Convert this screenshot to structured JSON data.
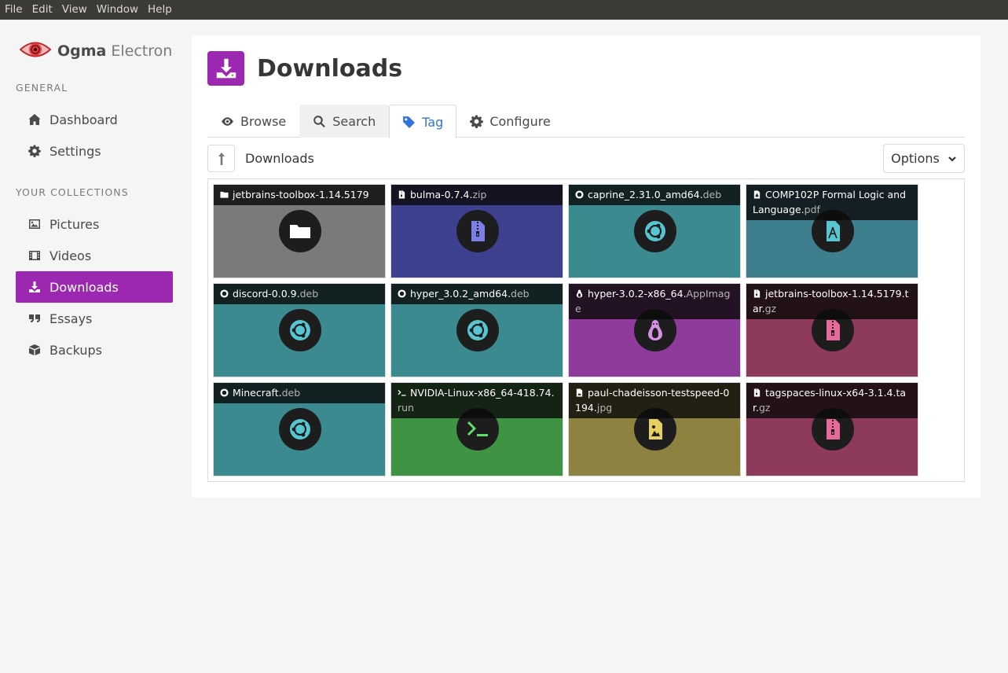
{
  "menubar": [
    "File",
    "Edit",
    "View",
    "Window",
    "Help"
  ],
  "brand": {
    "name_bold": "Ogma",
    "name_light": "Electron"
  },
  "sidebar": {
    "general_label": "GENERAL",
    "general_items": [
      {
        "label": "Dashboard",
        "icon": "home-icon"
      },
      {
        "label": "Settings",
        "icon": "gear-icon"
      }
    ],
    "collections_label": "YOUR COLLECTIONS",
    "collection_items": [
      {
        "label": "Pictures",
        "icon": "image-icon"
      },
      {
        "label": "Videos",
        "icon": "film-icon"
      },
      {
        "label": "Downloads",
        "icon": "download-icon",
        "active": true
      },
      {
        "label": "Essays",
        "icon": "quote-icon"
      },
      {
        "label": "Backups",
        "icon": "box-icon"
      }
    ]
  },
  "page": {
    "title": "Downloads",
    "accent": "#9c27b0"
  },
  "tabs": [
    {
      "label": "Browse",
      "icon": "eye-icon"
    },
    {
      "label": "Search",
      "icon": "search-icon"
    },
    {
      "label": "Tag",
      "icon": "tag-icon",
      "active": true
    },
    {
      "label": "Configure",
      "icon": "gear-icon"
    }
  ],
  "pathbar": {
    "path": "Downloads",
    "options_label": "Options"
  },
  "files": [
    {
      "name": "jetbrains-toolbox-1.14.5179",
      "ext": "",
      "kind": "folder",
      "bg": "#7a7a7a",
      "icon_color": "#ffffff"
    },
    {
      "name": "bulma-0.7.4.",
      "ext": "zip",
      "kind": "archive",
      "bg": "#3d3f8f",
      "icon_color": "#7b7fe6"
    },
    {
      "name": "caprine_2.31.0_amd64.",
      "ext": "deb",
      "kind": "deb",
      "bg": "#3a8a90",
      "icon_color": "#56c6d2"
    },
    {
      "name": "COMP102P Formal Logic and Language.",
      "ext": "pdf",
      "kind": "pdf",
      "bg": "#3d7f8f",
      "icon_color": "#56c6d2"
    },
    {
      "name": "discord-0.0.9.",
      "ext": "deb",
      "kind": "deb",
      "bg": "#3a8a90",
      "icon_color": "#56c6d2"
    },
    {
      "name": "hyper_3.0.2_amd64.",
      "ext": "deb",
      "kind": "deb",
      "bg": "#3a8a90",
      "icon_color": "#56c6d2"
    },
    {
      "name": "hyper-3.0.2-x86_64.",
      "ext": "AppImage",
      "kind": "linux",
      "bg": "#8e3b9c",
      "icon_color": "#d88fe6"
    },
    {
      "name": "jetbrains-toolbox-1.14.5179.tar.",
      "ext": "gz",
      "kind": "archive",
      "bg": "#8e3a5c",
      "icon_color": "#e86a9c"
    },
    {
      "name": "Minecraft.",
      "ext": "deb",
      "kind": "deb",
      "bg": "#3a8a90",
      "icon_color": "#56c6d2"
    },
    {
      "name": "NVIDIA-Linux-x86_64-418.74.",
      "ext": "run",
      "kind": "terminal",
      "bg": "#3f9444",
      "icon_color": "#5ee06a"
    },
    {
      "name": "paul-chadeisson-testspeed-0194.",
      "ext": "jpg",
      "kind": "image",
      "bg": "#8e8240",
      "icon_color": "#e6d060"
    },
    {
      "name": "tagspaces-linux-x64-3.1.4.tar.",
      "ext": "gz",
      "kind": "archive",
      "bg": "#8e3a5c",
      "icon_color": "#e86a9c"
    }
  ]
}
